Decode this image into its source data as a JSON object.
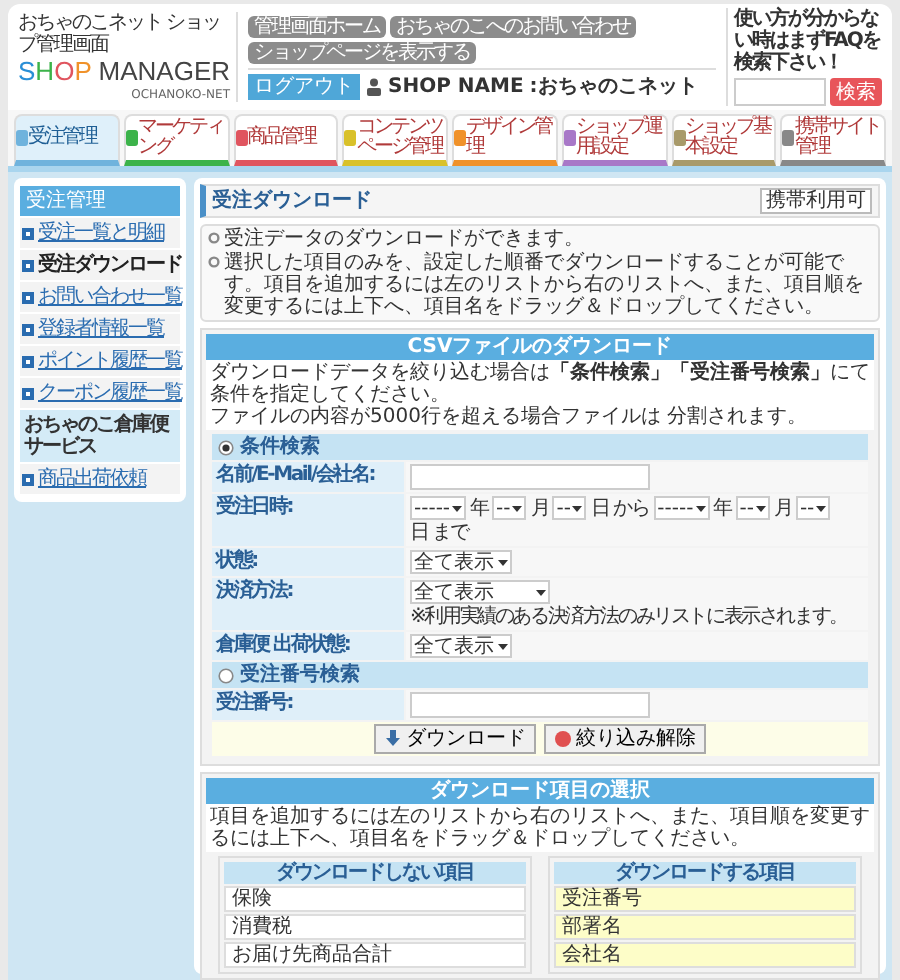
{
  "header": {
    "subtitle": "おちゃのこネット ショップ管理画面",
    "logo": "SHOP MANAGER",
    "logo_sub": "OCHANOKO-NET",
    "top_links": [
      "管理画面ホーム",
      "おちゃのこへのお問い合わせ",
      "ショップページを表示する"
    ],
    "logout": "ログアウト",
    "shop_name_label": "SHOP NAME",
    "shop_name": ":おちゃのこネット",
    "faq_text": "使い方が分からない時はまずFAQを検索下さい！",
    "faq_button": "検索"
  },
  "tabs": [
    {
      "label": "受注管理",
      "selected": true,
      "color": "#6fb3dd"
    },
    {
      "label": "マーケティング",
      "selected": false,
      "color": "#3cb34a"
    },
    {
      "label": "商品管理",
      "selected": false,
      "color": "#e0555f"
    },
    {
      "label": "コンテンツページ管理",
      "selected": false,
      "color": "#d9c12a"
    },
    {
      "label": "デザイン管理",
      "selected": false,
      "color": "#f0922a"
    },
    {
      "label": "ショップ運用設定",
      "selected": false,
      "color": "#a878c8"
    },
    {
      "label": "ショップ基本設定",
      "selected": false,
      "color": "#a89a6a"
    },
    {
      "label": "携帯サイト管理",
      "selected": false,
      "color": "#888888"
    }
  ],
  "sidebar": {
    "heading": "受注管理",
    "items": [
      {
        "label": "受注一覧と明細",
        "selected": false
      },
      {
        "label": "受注ダウンロード",
        "selected": true
      },
      {
        "label": "お問い合わせ一覧",
        "selected": false
      },
      {
        "label": "登録者情報一覧",
        "selected": false
      },
      {
        "label": "ポイント履歴一覧",
        "selected": false
      },
      {
        "label": "クーポン履歴一覧",
        "selected": false
      }
    ],
    "section": "おちゃのこ倉庫便サービス",
    "section_items": [
      {
        "label": "商品出荷依頼",
        "selected": false
      }
    ]
  },
  "main": {
    "title": "受注ダウンロード",
    "badge": "携帯利用可",
    "notes": [
      "受注データのダウンロードができます。",
      "選択した項目のみを、設定した順番でダウンロードすることが可能です。項目を追加するには左のリストから右のリストへ、また、項目順を変更するには上下へ、項目名をドラッグ＆ドロップしてください。"
    ]
  },
  "csv": {
    "title": "CSVファイルのダウンロード",
    "description": [
      "ダウンロードデータを絞り込む場合は**「条件検索」「受注番号検索」**にて条件を指定してください。",
      "ファイルの内容が5000行を超える場合ファイルは 分割されます。"
    ],
    "groups": [
      {
        "label": "条件検索",
        "selected": true,
        "rows": [
          {
            "kind": "text",
            "label": "名前/E-Mail/会社名:",
            "value": ""
          },
          {
            "kind": "date",
            "label": "受注日時:",
            "parts": [
              {
                "value": "-----",
                "unit": "年"
              },
              {
                "value": "--",
                "unit": "月"
              },
              {
                "value": "--",
                "unit": "日 から"
              },
              {
                "value": "-----",
                "unit": "年"
              },
              {
                "value": "--",
                "unit": "月"
              },
              {
                "value": "--",
                "unit": "日 まで"
              }
            ]
          },
          {
            "kind": "select",
            "label": "状態:",
            "value": "全て表示"
          },
          {
            "kind": "select",
            "label": "決済方法:",
            "value": "全て表示",
            "note": "※利用実績のある決済方法のみリストに表示されます。"
          },
          {
            "kind": "select",
            "label": "倉庫便 出荷状態:",
            "value": "全て表示"
          }
        ]
      },
      {
        "label": "受注番号検索",
        "selected": false,
        "rows": [
          {
            "kind": "text",
            "label": "受注番号:",
            "value": ""
          }
        ]
      }
    ],
    "buttons": [
      "ダウンロード",
      "絞り込み解除"
    ]
  },
  "selection": {
    "title": "ダウンロード項目の選択",
    "description": "項目を追加するには左のリストから右のリストへ、また、項目順を変更するには上下へ、項目名をドラッグ＆ドロップしてください。",
    "lists": [
      {
        "title": "ダウンロードしない項目",
        "included": false,
        "items": [
          "保険",
          "消費税",
          "お届け先商品合計"
        ]
      },
      {
        "title": "ダウンロードする項目",
        "included": true,
        "items": [
          "受注番号",
          "部署名",
          "会社名"
        ]
      }
    ]
  }
}
